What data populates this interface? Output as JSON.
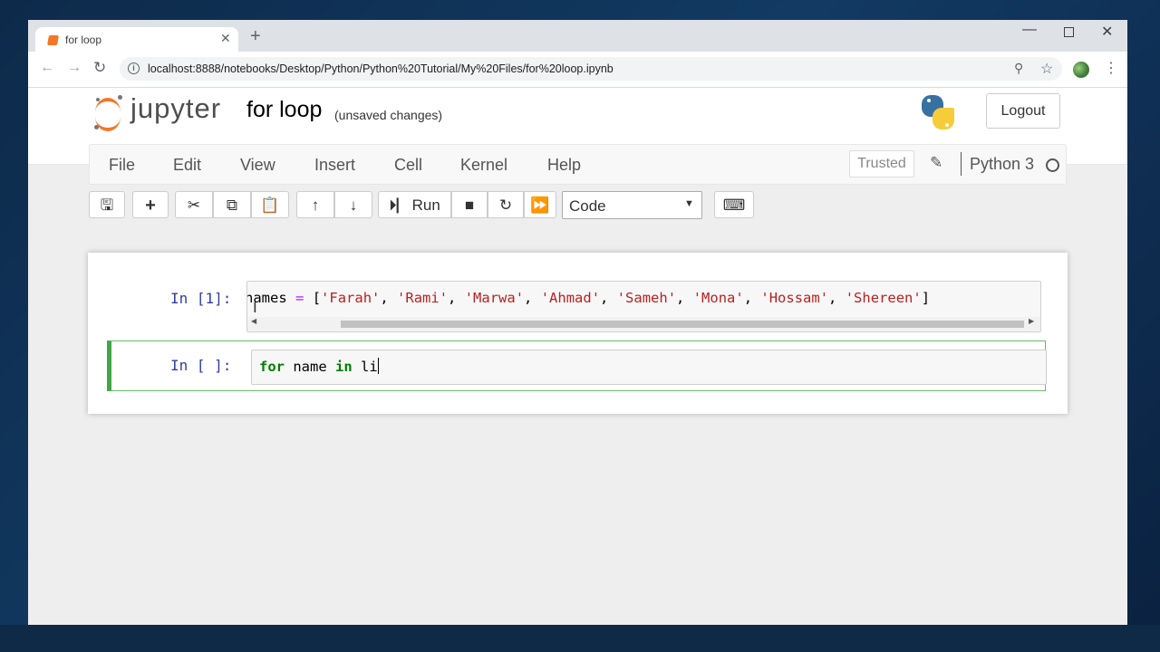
{
  "browser": {
    "tab_title": "for loop",
    "url": "localhost:8888/notebooks/Desktop/Python/Python%20Tutorial/My%20Files/for%20loop.ipynb",
    "icons": [
      "back-icon",
      "forward-icon",
      "reload-icon",
      "info-icon",
      "zoom-icon",
      "star-icon",
      "profile-avatar",
      "menu-icon"
    ]
  },
  "header": {
    "logo_text": "jupyter",
    "notebook_name": "for loop",
    "save_status": "(unsaved changes)",
    "logout_label": "Logout"
  },
  "menubar": {
    "items": [
      "File",
      "Edit",
      "View",
      "Insert",
      "Cell",
      "Kernel",
      "Help"
    ],
    "trusted_label": "Trusted",
    "kernel_name": "Python 3"
  },
  "toolbar": {
    "run_label": "Run",
    "cell_type": "Code",
    "icons": [
      "save-icon",
      "plus-icon",
      "cut-icon",
      "copy-icon",
      "paste-icon",
      "arrow-up-icon",
      "arrow-down-icon",
      "run-icon",
      "stop-icon",
      "restart-icon",
      "fast-forward-icon",
      "keyboard-icon"
    ]
  },
  "cells": [
    {
      "prompt": "In [1]:",
      "tokens": [
        {
          "t": "names",
          "c": "var"
        },
        {
          "t": " ",
          "c": "var"
        },
        {
          "t": "=",
          "c": "op"
        },
        {
          "t": " [",
          "c": "var"
        },
        {
          "t": "'Farah'",
          "c": "str"
        },
        {
          "t": ", ",
          "c": "var"
        },
        {
          "t": "'Rami'",
          "c": "str"
        },
        {
          "t": ", ",
          "c": "var"
        },
        {
          "t": "'Marwa'",
          "c": "str"
        },
        {
          "t": ", ",
          "c": "var"
        },
        {
          "t": "'Ahmad'",
          "c": "str"
        },
        {
          "t": ", ",
          "c": "var"
        },
        {
          "t": "'Sameh'",
          "c": "str"
        },
        {
          "t": ", ",
          "c": "var"
        },
        {
          "t": "'Mona'",
          "c": "str"
        },
        {
          "t": ", ",
          "c": "var"
        },
        {
          "t": "'Hossam'",
          "c": "str"
        },
        {
          "t": ", ",
          "c": "var"
        },
        {
          "t": "'Shereen'",
          "c": "str"
        },
        {
          "t": "]",
          "c": "var"
        }
      ]
    },
    {
      "prompt": "In [ ]:",
      "tokens": [
        {
          "t": "for",
          "c": "kw"
        },
        {
          "t": " name ",
          "c": "var"
        },
        {
          "t": "in",
          "c": "kw"
        },
        {
          "t": " li",
          "c": "var"
        }
      ]
    }
  ],
  "colors": {
    "accent": "#f37726",
    "selected_cell": "#42a546",
    "prompt": "#303f9f",
    "string": "#ba2121",
    "keyword": "#008000",
    "operator": "#aa22ff"
  }
}
